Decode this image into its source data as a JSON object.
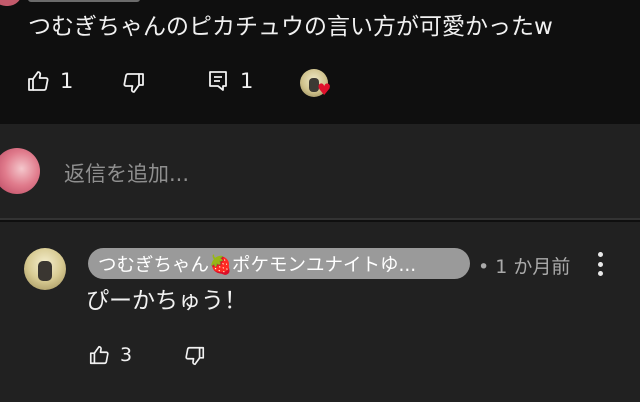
{
  "comment": {
    "text": "つむぎちゃんのピカチュウの言い方が可愛かったw",
    "like_count": "1",
    "reply_count": "1",
    "icons": [
      "like-icon",
      "dislike-icon",
      "reply-icon",
      "creator-heart-icon"
    ]
  },
  "add_reply": {
    "placeholder": "返信を追加..."
  },
  "reply": {
    "author": "つむぎちゃん🍓ポケモンユナイトゆ...",
    "time": "• 1 か月前",
    "text": "ぴーかちゅう！",
    "like_count": "3"
  },
  "colors": {
    "background": "#0f0f0f",
    "panel": "#212121",
    "author_pill": "#9a9a9a",
    "heart": "#e0102c"
  }
}
